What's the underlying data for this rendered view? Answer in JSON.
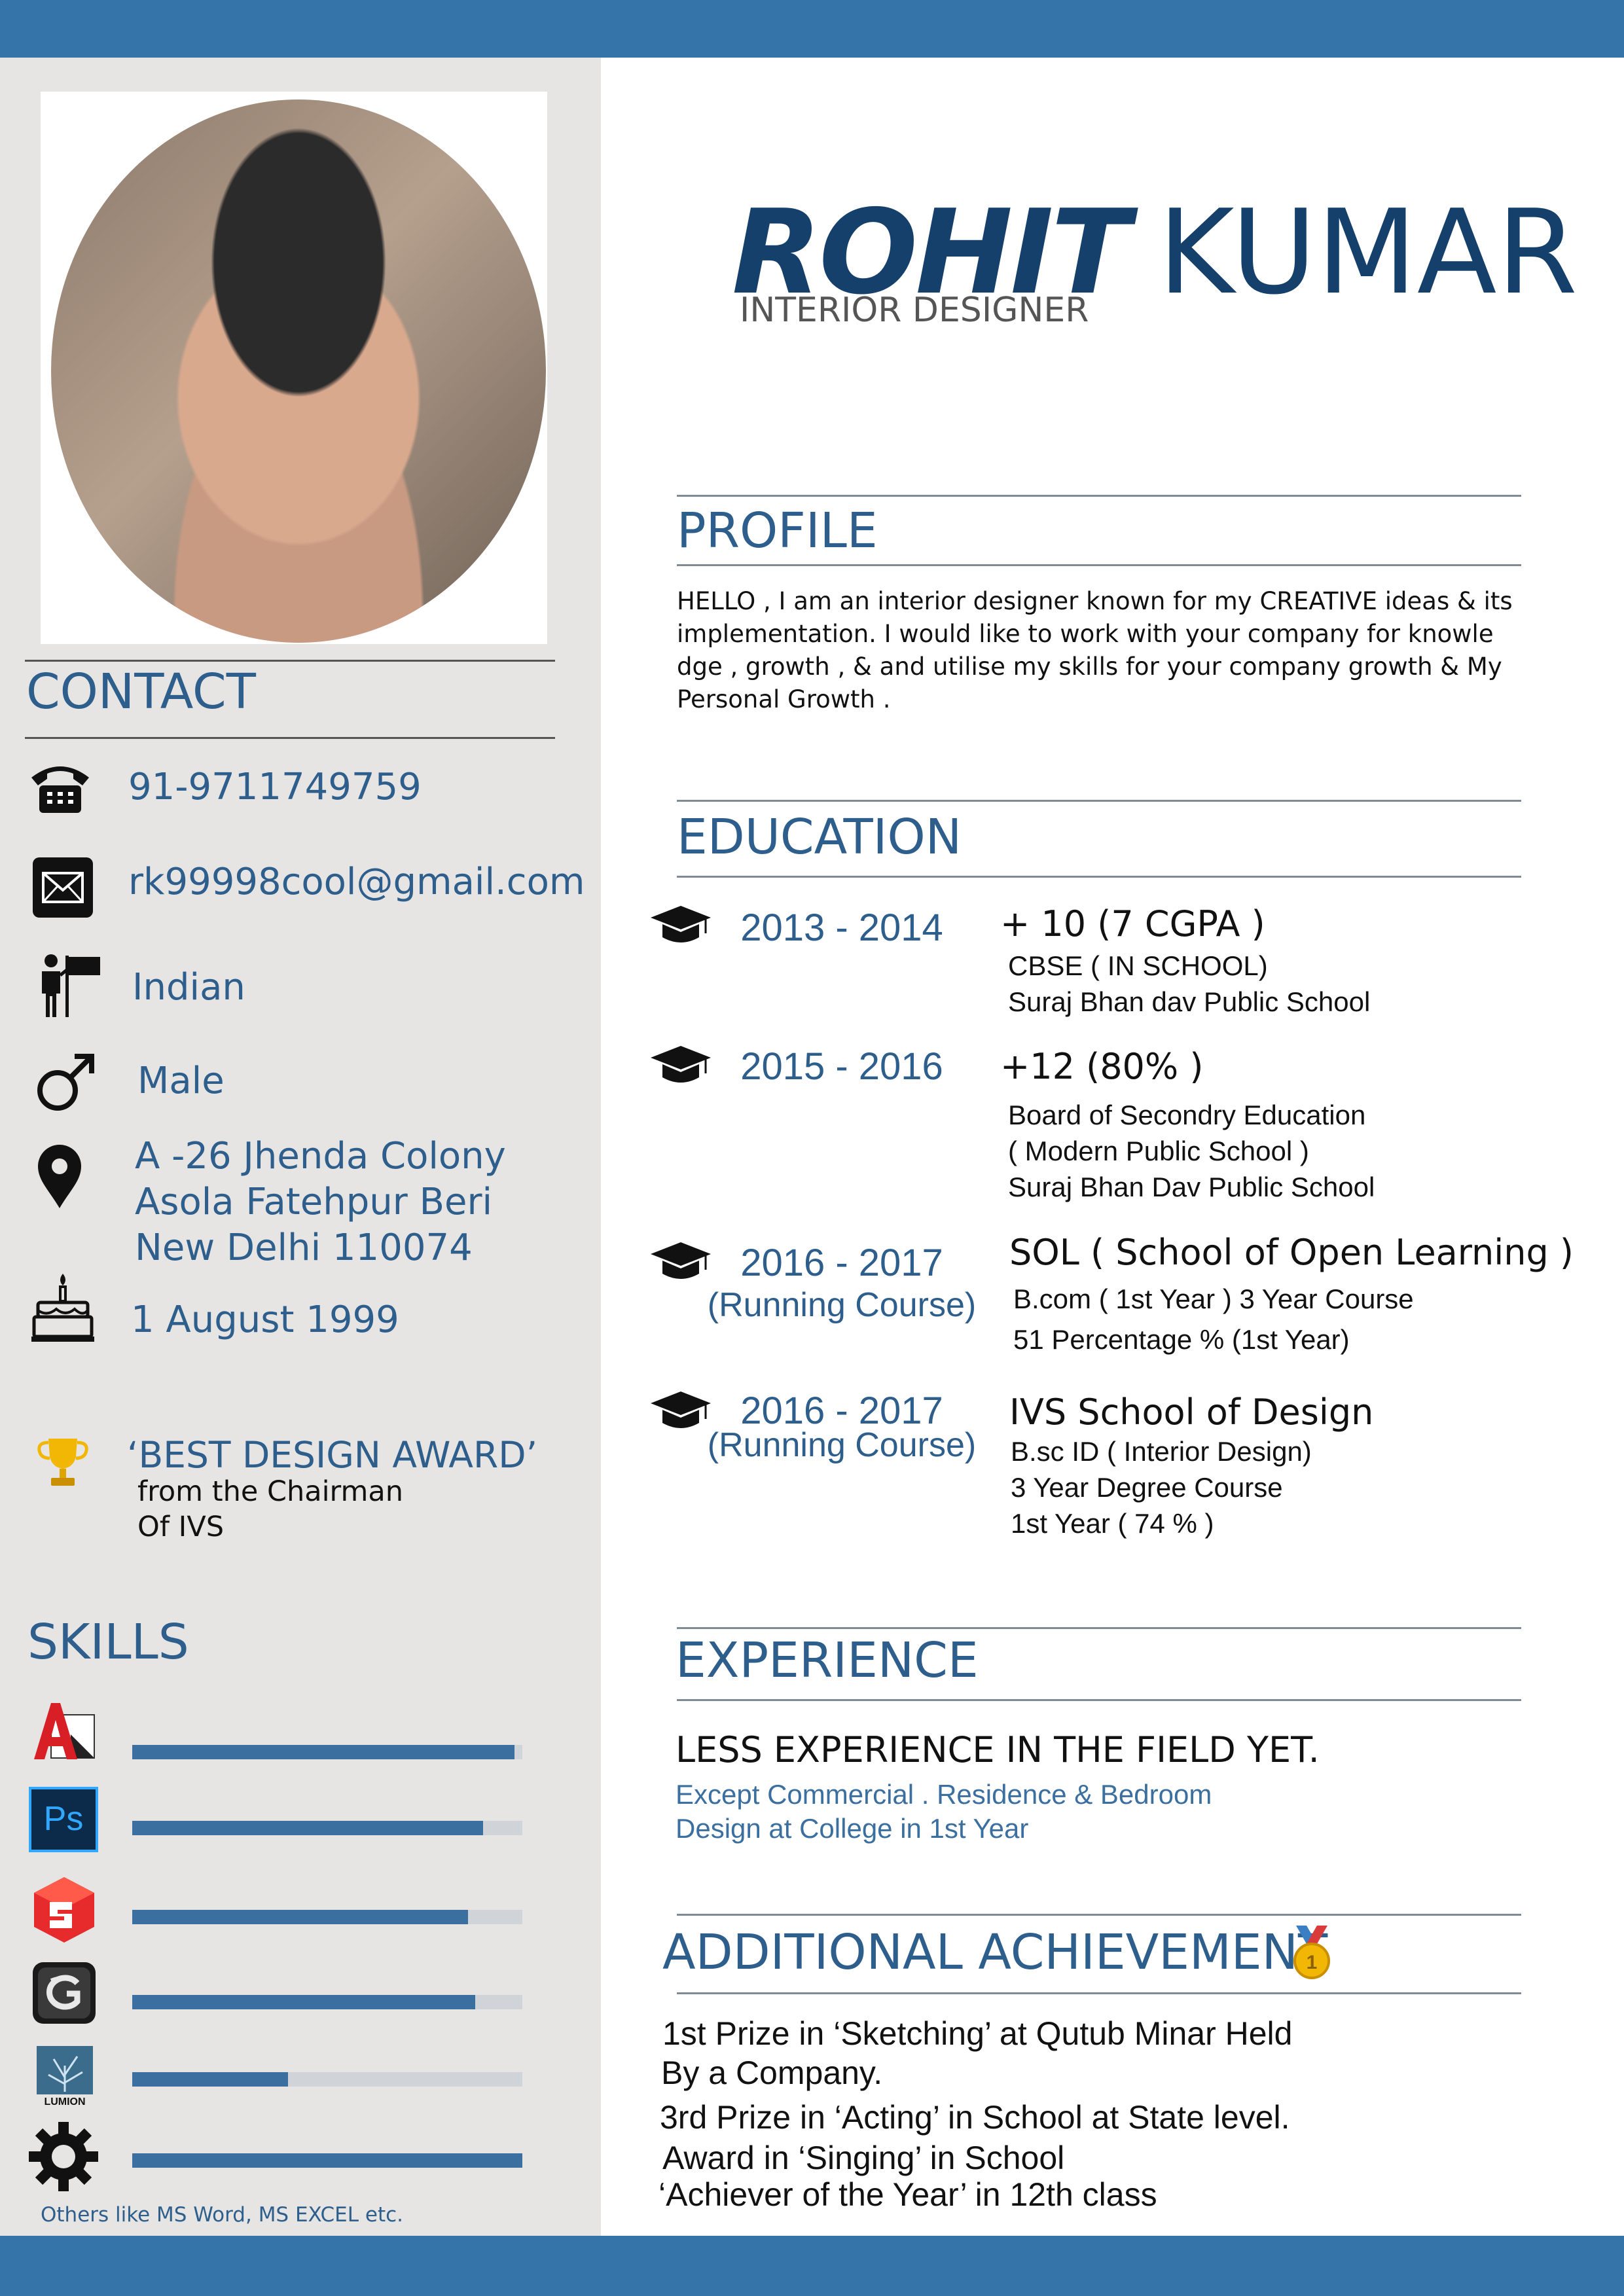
{
  "colors": {
    "accent": "#3574a8",
    "sidebar": "#e6e5e4",
    "heading": "#2e5e8c",
    "name": "#15406b"
  },
  "header": {
    "first_name": "ROHIT",
    "last_name": "KUMAR",
    "title": "INTERIOR DESIGNER"
  },
  "contact": {
    "heading": "CONTACT",
    "phone": "91-9711749759",
    "email": "rk99998cool@gmail.com",
    "nationality": "Indian",
    "gender": "Male",
    "address": [
      "A -26 Jhenda Colony",
      "Asola Fatehpur Beri",
      "New Delhi 110074"
    ],
    "birthday": "1 August 1999"
  },
  "award": {
    "title": "‘BEST DESIGN AWARD’",
    "line1": "from the Chairman",
    "line2": "Of IVS"
  },
  "skills": {
    "heading": "SKILLS",
    "items": [
      {
        "icon": "autocad-icon",
        "level": 0.98
      },
      {
        "icon": "photoshop-icon",
        "level": 0.9
      },
      {
        "icon": "sketchup-icon",
        "level": 0.86
      },
      {
        "icon": "3dsmax-icon",
        "level": 0.88
      },
      {
        "icon": "lumion-icon",
        "level": 0.4
      },
      {
        "icon": "gear-icon",
        "level": 1.0
      }
    ],
    "ps_label": "Ps",
    "lumion_label": "LUMION",
    "note": "Others like MS Word, MS EXCEL etc."
  },
  "profile": {
    "heading": "PROFILE",
    "lines": [
      "HELLO , I am an interior designer known for my CREATIVE ideas & its",
      "implementation. I  would like to work with your company for knowle",
      "dge , growth , & and utilise my skills for your company growth & My",
      "Personal Growth ."
    ]
  },
  "education": {
    "heading": "EDUCATION",
    "entries": [
      {
        "year": "2013 - 2014",
        "note": "",
        "title": "+ 10 (7 CGPA )",
        "lines": [
          "CBSE ( IN SCHOOL)",
          "Suraj Bhan dav Public School"
        ]
      },
      {
        "year": "2015 - 2016",
        "note": "",
        "title": "+12 (80% )",
        "lines": [
          "Board of Secondry Education",
          "( Modern Public School )",
          "Suraj Bhan Dav Public School"
        ]
      },
      {
        "year": "2016 - 2017",
        "note": "(Running Course)",
        "title": "SOL ( School of Open Learning )",
        "lines": [
          "B.com ( 1st Year ) 3 Year Course",
          "51 Percentage % (1st Year)"
        ]
      },
      {
        "year": "2016 - 2017",
        "note": "(Running Course)",
        "title": "IVS School of Design",
        "lines": [
          "B.sc ID ( Interior Design)",
          "3 Year Degree Course",
          "1st Year ( 74 % )"
        ]
      }
    ]
  },
  "experience": {
    "heading": "EXPERIENCE",
    "headline": "LESS EXPERIENCE IN THE FIELD YET.",
    "lines": [
      "Except Commercial . Residence & Bedroom",
      "Design at College in 1st Year"
    ]
  },
  "achievement": {
    "heading": "ADDITIONAL ACHIEVEMENT",
    "medal_label": "1",
    "lines": [
      "1st Prize in ‘Sketching’ at Qutub Minar Held",
      "By a Company.",
      "3rd Prize in ‘Acting’ in School  at State level.",
      "Award in ‘Singing’ in School",
      "‘Achiever of the Year’ in 12th class"
    ]
  }
}
